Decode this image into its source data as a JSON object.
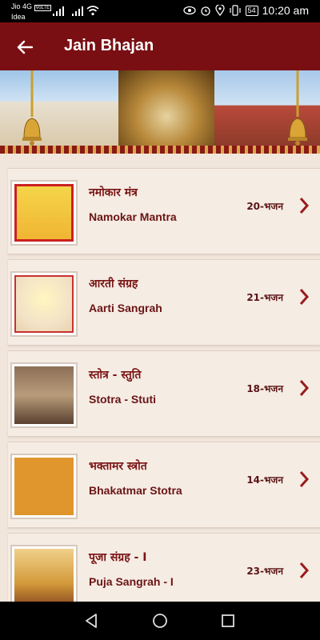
{
  "status": {
    "carrier": "Jio 4G",
    "carrier_badge": "VoLTE",
    "carrier2": "Idea",
    "battery": "54",
    "time": "10:20 am"
  },
  "app_bar": {
    "title": "Jain Bhajan"
  },
  "items": [
    {
      "title_hi": "नमोकार मंत्र",
      "title_en": "Namokar Mantra",
      "count": "20-भजन"
    },
    {
      "title_hi": "आरती संग्रह",
      "title_en": "Aarti Sangrah",
      "count": "21-भजन"
    },
    {
      "title_hi": "स्तोत्र - स्तुति",
      "title_en": "Stotra - Stuti",
      "count": "18-भजन"
    },
    {
      "title_hi": "भक्तामर स्त्रोत",
      "title_en": "Bhakatmar Stotra",
      "count": "14-भजन"
    },
    {
      "title_hi": "पूजा संग्रह - I",
      "title_en": "Puja Sangrah - I",
      "count": "23-भजन"
    }
  ],
  "icons": {
    "back": "arrow-left-icon",
    "chevron": "chevron-right-icon"
  },
  "colors": {
    "app_bar": "#7a0f13",
    "list_bg": "#f1e6dc",
    "accent": "#9a1b1b"
  }
}
